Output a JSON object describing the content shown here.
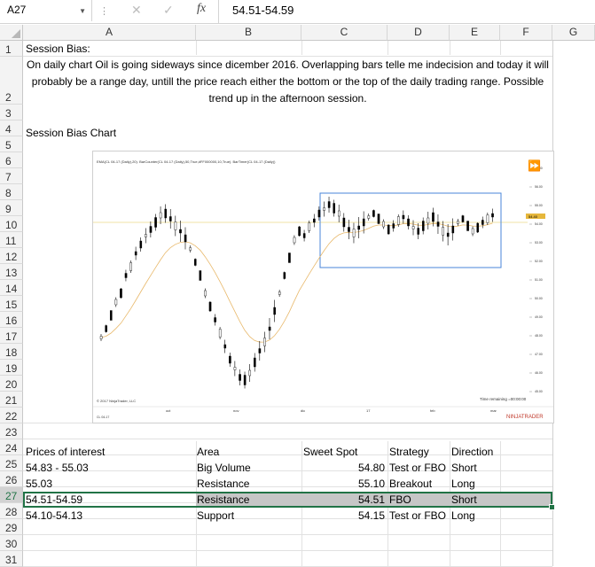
{
  "formula_bar": {
    "name_box": "A27",
    "fx_label": "fx",
    "formula": "54.51-54.59"
  },
  "columns": [
    "A",
    "B",
    "C",
    "D",
    "E",
    "F",
    "G"
  ],
  "rows": [
    "1",
    "2",
    "3",
    "4",
    "5",
    "6",
    "7",
    "8",
    "9",
    "10",
    "11",
    "12",
    "13",
    "14",
    "15",
    "16",
    "17",
    "18",
    "19",
    "20",
    "21",
    "22",
    "23",
    "24",
    "25",
    "26",
    "27",
    "28",
    "29",
    "30",
    "31"
  ],
  "sheet": {
    "a1": "Session Bias:",
    "a2": "On daily chart Oil is going sideways since dicember 2016. Overlapping bars telle me indecision and today it will probably be a range day, untill the price reach either the bottom or the top of the daily trading range. Possible trend up in the afternoon session.",
    "a4": "Session Bias Chart",
    "table": {
      "headers": {
        "a": "Prices of interest",
        "b": "Area",
        "c": "Sweet Spot",
        "d": "Strategy",
        "e": "Direction"
      },
      "rows": [
        {
          "a": "54.83 - 55.03",
          "b": "Big Volume",
          "c": "54.80",
          "d": "Test or FBO",
          "e": "Short"
        },
        {
          "a": "55.03",
          "b": "Resistance",
          "c": "55.10",
          "d": "Breakout",
          "e": "Long"
        },
        {
          "a": "54.51-54.59",
          "b": "Resistance",
          "c": "54.51",
          "d": "FBO",
          "e": "Short"
        },
        {
          "a": "54.10-54.13",
          "b": "Support",
          "c": "54.15",
          "d": "Test or FBO",
          "e": "Long"
        }
      ]
    }
  },
  "chart": {
    "header": "EMA(CL 04-17 (Daily),20). BarCounter(CL 04-17 (Daily),50,True,#FF000000,10,True). BarTimer(CL 04-17 (Daily))",
    "copyright": "© 2017 NinjaTrader, LLC",
    "time_remaining": "Time remaining =00:00:00",
    "instrument": "CL 04-17",
    "brand": "NINJATRADER",
    "x_labels": [
      "oct",
      "nov",
      "dic",
      "17",
      "feb",
      "mar"
    ],
    "y_labels": [
      "57.00",
      "56.00",
      "55.00",
      "54.00",
      "53.00",
      "52.00",
      "51.00",
      "50.00",
      "49.00",
      "48.00",
      "47.00",
      "46.00",
      "45.00"
    ],
    "price_marker": "54.40",
    "colors": {
      "candle": "#000000",
      "ema": "#e8b86a",
      "range_box": "#4a86d8",
      "price_line": "#e6c84a",
      "marker": "#e6b73c"
    }
  }
}
